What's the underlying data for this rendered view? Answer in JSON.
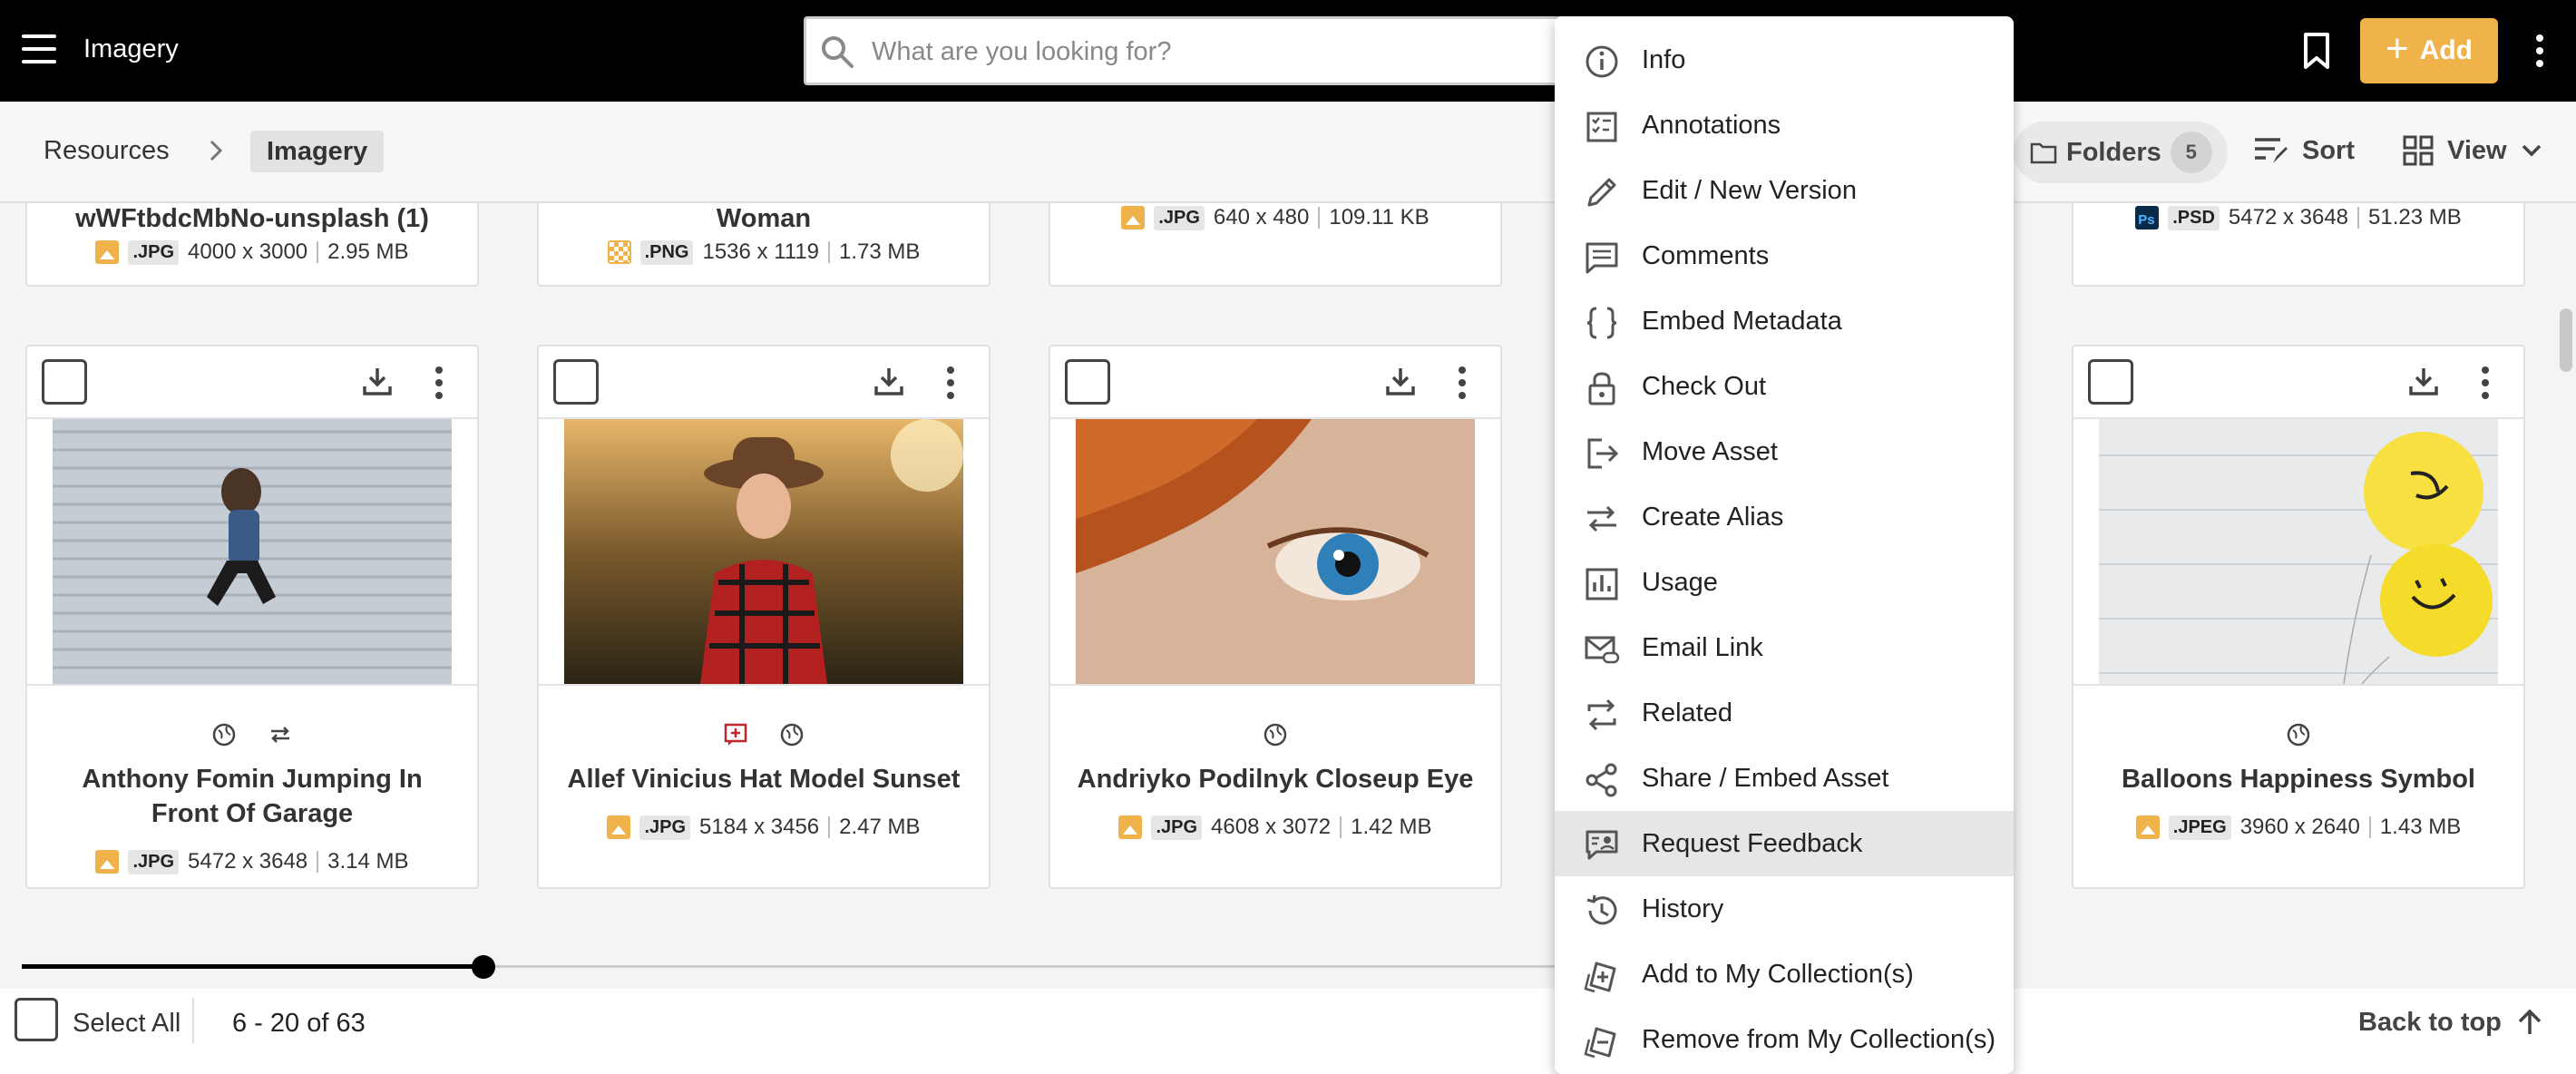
{
  "header": {
    "app_title": "Imagery",
    "search_placeholder": "What are you looking for?",
    "add_label": "Add"
  },
  "breadcrumb": {
    "root": "Resources",
    "current": "Imagery"
  },
  "toolbar": {
    "folders_label": "Folders",
    "folders_count": "5",
    "sort_label": "Sort",
    "view_label": "View"
  },
  "top_row": [
    {
      "title": "wWFtbdcMbNo-unsplash (1)",
      "ext": ".JPG",
      "dims": "4000 x 3000",
      "size": "2.95 MB",
      "type": "image"
    },
    {
      "title": "Woman",
      "ext": ".PNG",
      "dims": "1536 x 1119",
      "size": "1.73 MB",
      "type": "png"
    },
    {
      "title": "",
      "ext": ".JPG",
      "dims": "640 x 480",
      "size": "109.11 KB",
      "type": "image"
    },
    {
      "title": "",
      "ext": ".PSD",
      "dims": "5472 x 3648",
      "size": "51.23 MB",
      "type": "psd"
    }
  ],
  "assets": [
    {
      "title": "Anthony Fomin Jumping In Front Of Garage",
      "ext": ".JPG",
      "dims": "5472 x 3648",
      "size": "3.14 MB"
    },
    {
      "title": "Allef Vinicius Hat Model Sunset",
      "ext": ".JPG",
      "dims": "5184 x 3456",
      "size": "2.47 MB"
    },
    {
      "title": "Andriyko Podilnyk Closeup Eye",
      "ext": ".JPG",
      "dims": "4608 x 3072",
      "size": "1.42 MB"
    },
    {
      "title": "Balloons Happiness Symbol",
      "ext": ".JPEG",
      "dims": "3960 x 2640",
      "size": "1.43 MB"
    }
  ],
  "bottom": {
    "select_all": "Select All",
    "page_range": "6 - 20 of 63",
    "back_to_top": "Back to top"
  },
  "menu": {
    "items": [
      {
        "label": "Info",
        "icon": "info-icon"
      },
      {
        "label": "Annotations",
        "icon": "annotations-icon"
      },
      {
        "label": "Edit / New Version",
        "icon": "pencil-icon"
      },
      {
        "label": "Comments",
        "icon": "comments-icon"
      },
      {
        "label": "Embed Metadata",
        "icon": "braces-icon"
      },
      {
        "label": "Check Out",
        "icon": "lock-icon"
      },
      {
        "label": "Move Asset",
        "icon": "move-icon"
      },
      {
        "label": "Create Alias",
        "icon": "alias-icon"
      },
      {
        "label": "Usage",
        "icon": "usage-icon"
      },
      {
        "label": "Email Link",
        "icon": "email-link-icon"
      },
      {
        "label": "Related",
        "icon": "related-icon"
      },
      {
        "label": "Share / Embed Asset",
        "icon": "share-icon"
      },
      {
        "label": "Request Feedback",
        "icon": "feedback-icon"
      },
      {
        "label": "History",
        "icon": "history-icon"
      },
      {
        "label": "Add to My Collection(s)",
        "icon": "add-collection-icon"
      },
      {
        "label": "Remove from My Collection(s)",
        "icon": "remove-collection-icon"
      }
    ],
    "active_index": 12
  }
}
